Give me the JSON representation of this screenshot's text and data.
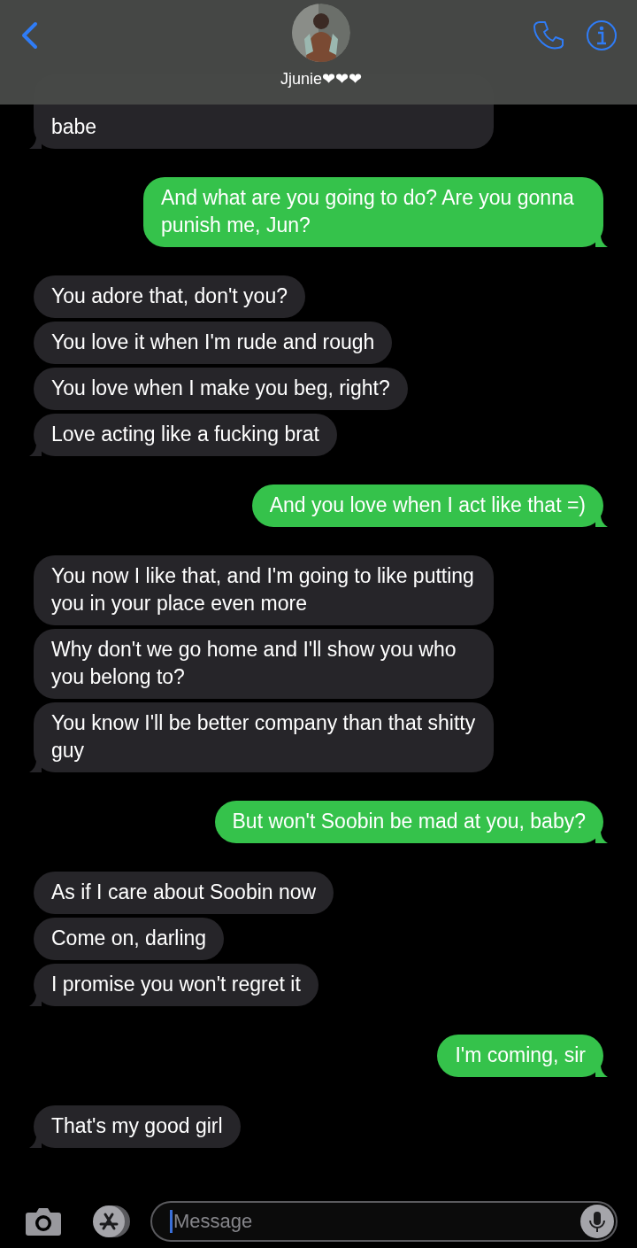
{
  "header": {
    "contact_name": "Jjunie❤❤❤"
  },
  "messages": [
    {
      "kind": "received_partial",
      "text": "babe",
      "tail": true
    },
    {
      "kind": "sent",
      "text": "And what are you going to do? Are you gonna punish me, Jun?",
      "tail": true
    },
    {
      "kind": "received",
      "text": "You adore that, don't you?",
      "tail": false
    },
    {
      "kind": "received",
      "text": "You love it when I'm rude and rough",
      "tail": false
    },
    {
      "kind": "received",
      "text": "You love when I make you beg, right?",
      "tail": false
    },
    {
      "kind": "received",
      "text": "Love acting like a fucking brat",
      "tail": true
    },
    {
      "kind": "sent",
      "text": "And you love when I act like that =)",
      "tail": true
    },
    {
      "kind": "received",
      "text": "You now I like that, and I'm going to like putting you in your place even more",
      "tail": false
    },
    {
      "kind": "received",
      "text": "Why don't we go home and I'll show you who you belong to?",
      "tail": false
    },
    {
      "kind": "received",
      "text": "You know I'll be better company than that shitty guy",
      "tail": true
    },
    {
      "kind": "sent",
      "text": "But won't Soobin be mad at you, baby?",
      "tail": true
    },
    {
      "kind": "received",
      "text": "As if I care about Soobin now",
      "tail": false
    },
    {
      "kind": "received",
      "text": "Come on, darling",
      "tail": false
    },
    {
      "kind": "received",
      "text": "I promise you won't regret it",
      "tail": true
    },
    {
      "kind": "sent",
      "text": "I'm coming, sir",
      "tail": true
    },
    {
      "kind": "received",
      "text": "That's my good girl",
      "tail": true
    }
  ],
  "composer": {
    "placeholder": "Message"
  }
}
